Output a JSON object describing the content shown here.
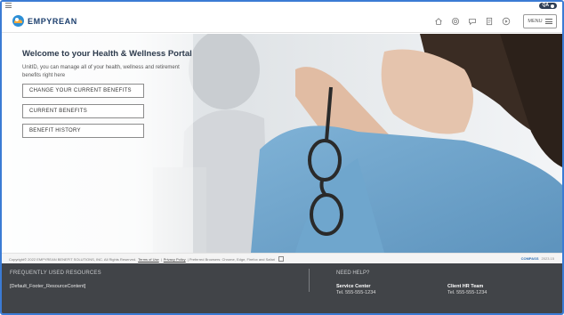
{
  "header": {
    "brand": "EMPYREAN",
    "env_badge": "QA",
    "menu_label": "MENU",
    "icons": [
      "home-icon",
      "support-icon",
      "chat-icon",
      "document-icon",
      "play-icon"
    ]
  },
  "hero": {
    "title": "Welcome to your Health & Wellness Portal",
    "subtitle": "UnitID, you can manage all of your health, wellness and retirement benefits right here",
    "buttons": [
      "CHANGE YOUR CURRENT BENEFITS",
      "CURRENT BENEFITS",
      "BENEFIT HISTORY"
    ]
  },
  "copyright": {
    "text": "Copyright© 2022 EMPYREAN BENEFIT SOLUTIONS, INC. All Rights Reserved.",
    "terms": "Terms of Use",
    "sep": "|",
    "privacy": "Privacy Policy",
    "browsers": "| Preferred Browsers: Chrome, Edge, Firefox and Safari",
    "right_brand": "COMPASS",
    "right_version": "2023.15"
  },
  "footer": {
    "resources_heading": "FREQUENTLY USED RESOURCES",
    "resources_content": "[Default_Footer_ResourceContent]",
    "help_heading": "NEED HELP?",
    "contacts": [
      {
        "name": "Service Center",
        "phone": "Tel. 555-555-1234"
      },
      {
        "name": "Client HR Team",
        "phone": "Tel. 555-555-1234"
      }
    ]
  },
  "colors": {
    "accent": "#3b7bd4",
    "brand": "#1c3f6e",
    "footer_bg": "#414448"
  }
}
